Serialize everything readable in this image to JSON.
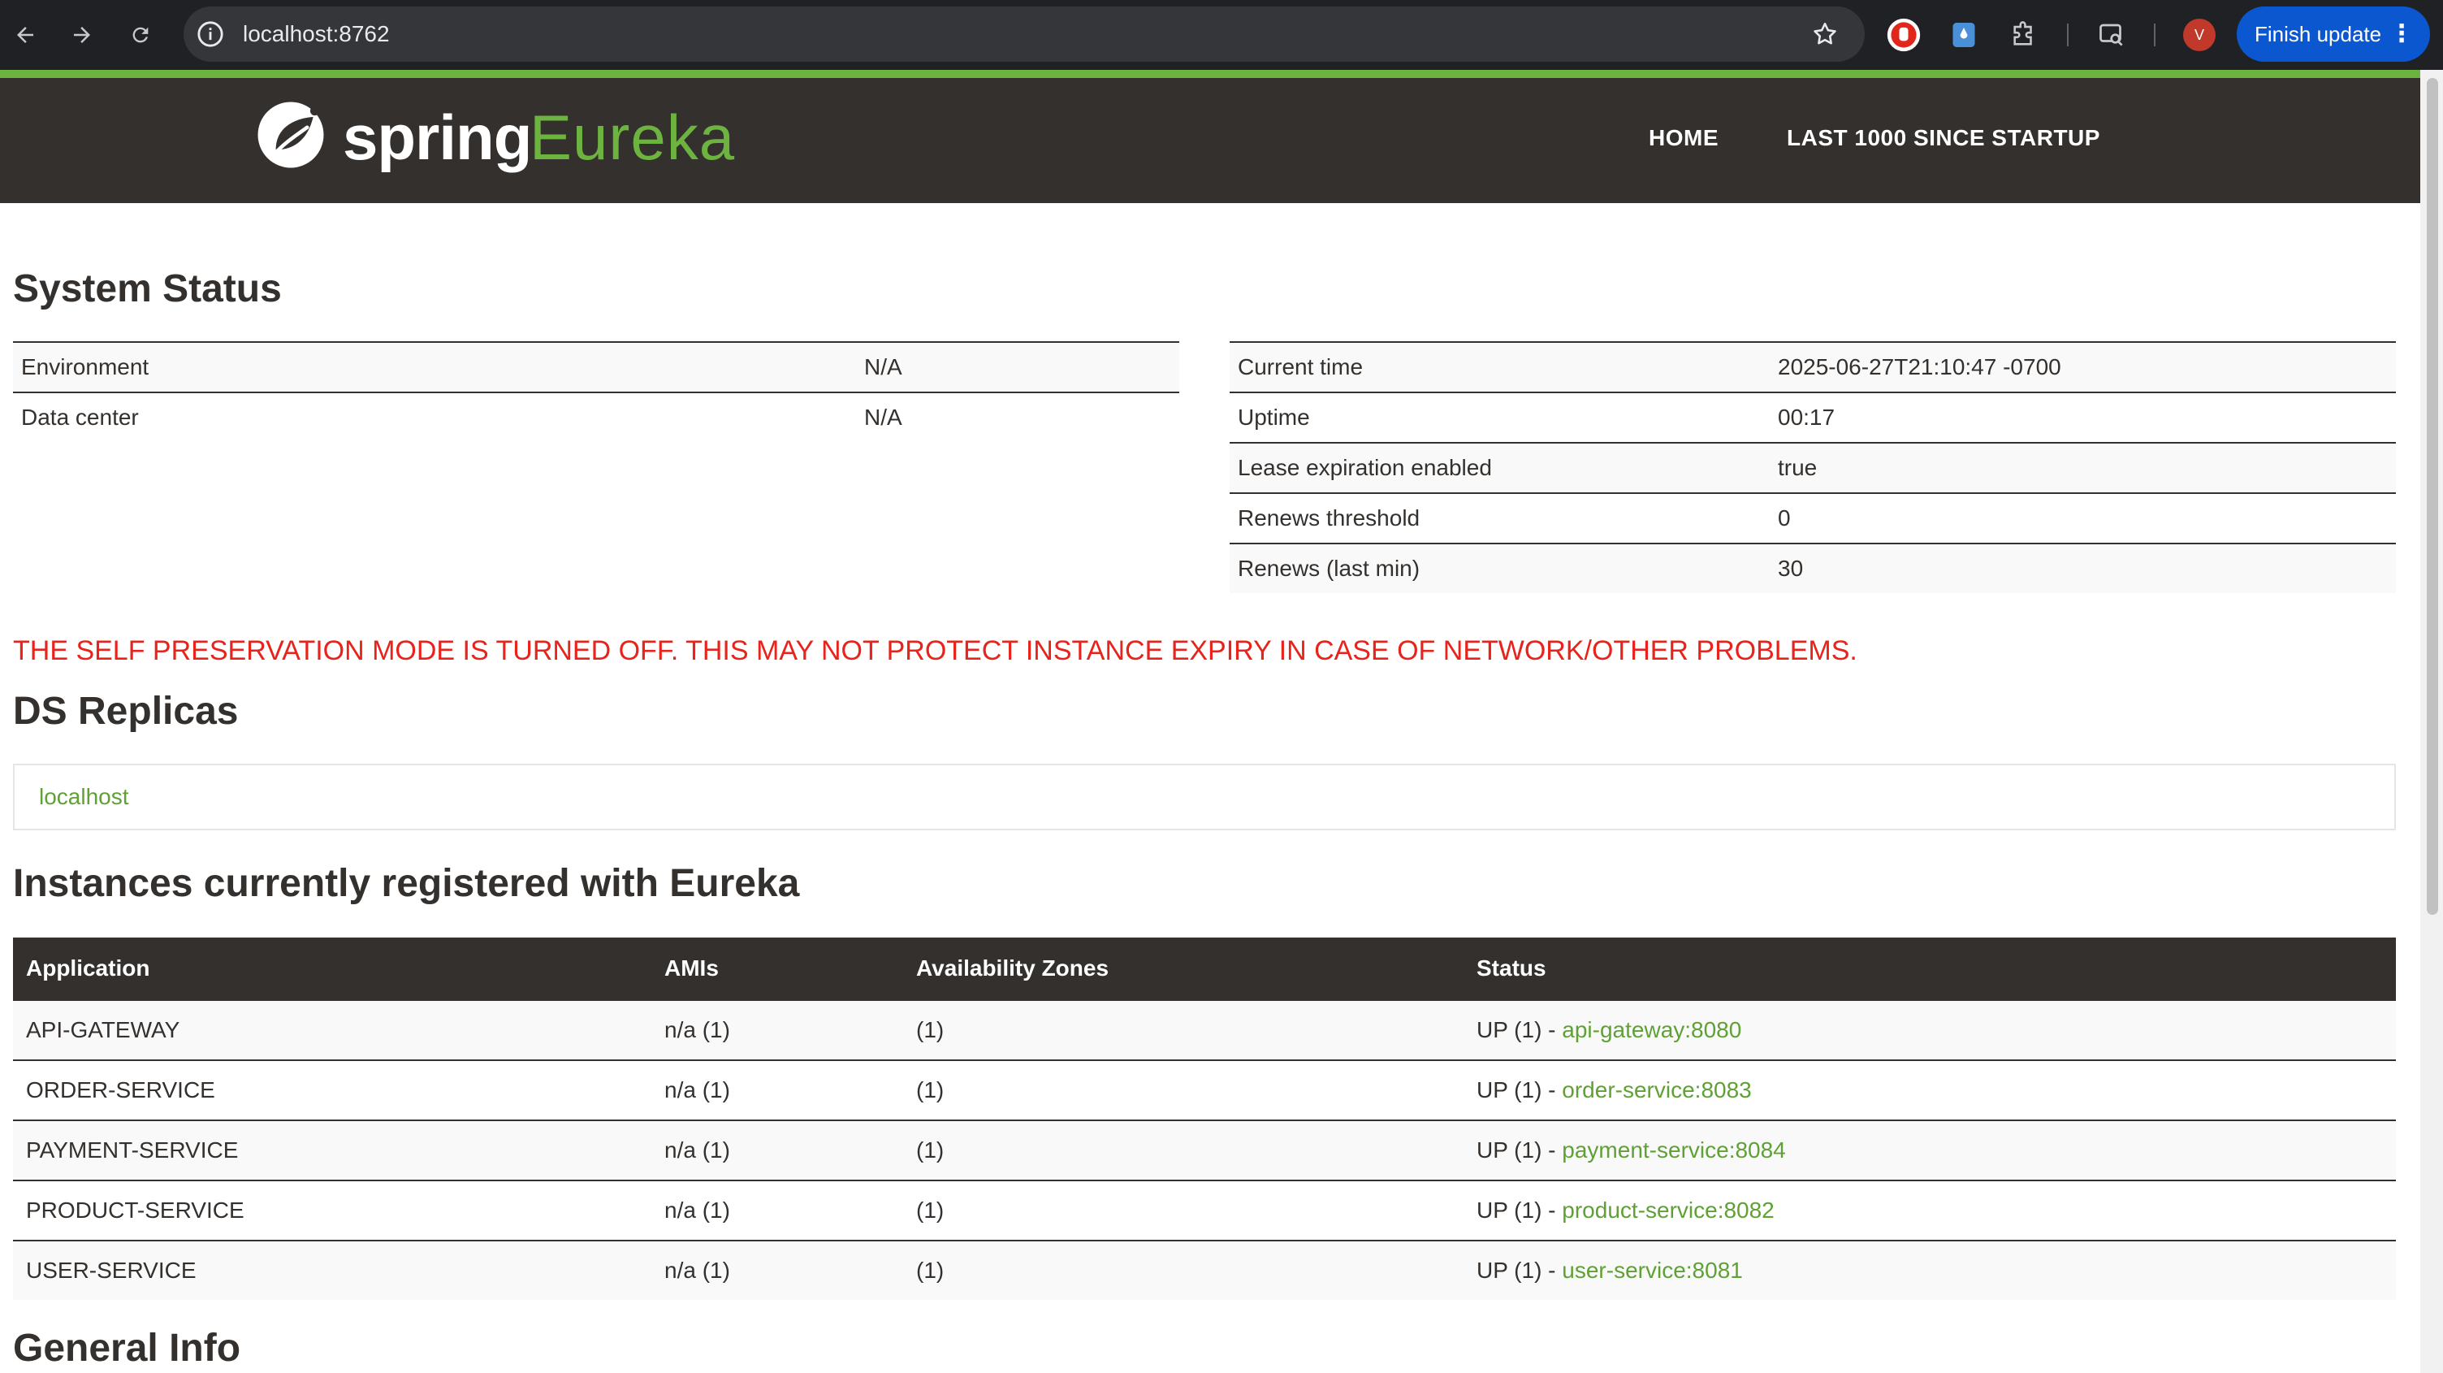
{
  "browser": {
    "url": "localhost:8762",
    "profile_initial": "V",
    "finish_update_label": "Finish update"
  },
  "header": {
    "logo_spring": "spring",
    "logo_eureka": "Eureka",
    "nav": [
      "HOME",
      "LAST 1000 SINCE STARTUP"
    ]
  },
  "system_status": {
    "title": "System Status",
    "left": [
      {
        "label": "Environment",
        "value": "N/A"
      },
      {
        "label": "Data center",
        "value": "N/A"
      }
    ],
    "right": [
      {
        "label": "Current time",
        "value": "2025-06-27T21:10:47 -0700"
      },
      {
        "label": "Uptime",
        "value": "00:17"
      },
      {
        "label": "Lease expiration enabled",
        "value": "true"
      },
      {
        "label": "Renews threshold",
        "value": "0"
      },
      {
        "label": "Renews (last min)",
        "value": "30"
      }
    ]
  },
  "warning": "THE SELF PRESERVATION MODE IS TURNED OFF. THIS MAY NOT PROTECT INSTANCE EXPIRY IN CASE OF NETWORK/OTHER PROBLEMS.",
  "ds_replicas": {
    "title": "DS Replicas",
    "items": [
      "localhost"
    ]
  },
  "instances": {
    "title": "Instances currently registered with Eureka",
    "columns": [
      "Application",
      "AMIs",
      "Availability Zones",
      "Status"
    ],
    "rows": [
      {
        "application": "API-GATEWAY",
        "amis": "n/a (1)",
        "zones": "(1)",
        "status_prefix": "UP (1) - ",
        "status_link": "api-gateway:8080"
      },
      {
        "application": "ORDER-SERVICE",
        "amis": "n/a (1)",
        "zones": "(1)",
        "status_prefix": "UP (1) - ",
        "status_link": "order-service:8083"
      },
      {
        "application": "PAYMENT-SERVICE",
        "amis": "n/a (1)",
        "zones": "(1)",
        "status_prefix": "UP (1) - ",
        "status_link": "payment-service:8084"
      },
      {
        "application": "PRODUCT-SERVICE",
        "amis": "n/a (1)",
        "zones": "(1)",
        "status_prefix": "UP (1) - ",
        "status_link": "product-service:8082"
      },
      {
        "application": "USER-SERVICE",
        "amis": "n/a (1)",
        "zones": "(1)",
        "status_prefix": "UP (1) - ",
        "status_link": "user-service:8081"
      }
    ]
  },
  "general_info": {
    "title": "General Info"
  },
  "colors": {
    "spring_green": "#6db33f",
    "header_dark": "#34302d",
    "warning_red": "#e8231b",
    "link_green": "#5fa134"
  }
}
